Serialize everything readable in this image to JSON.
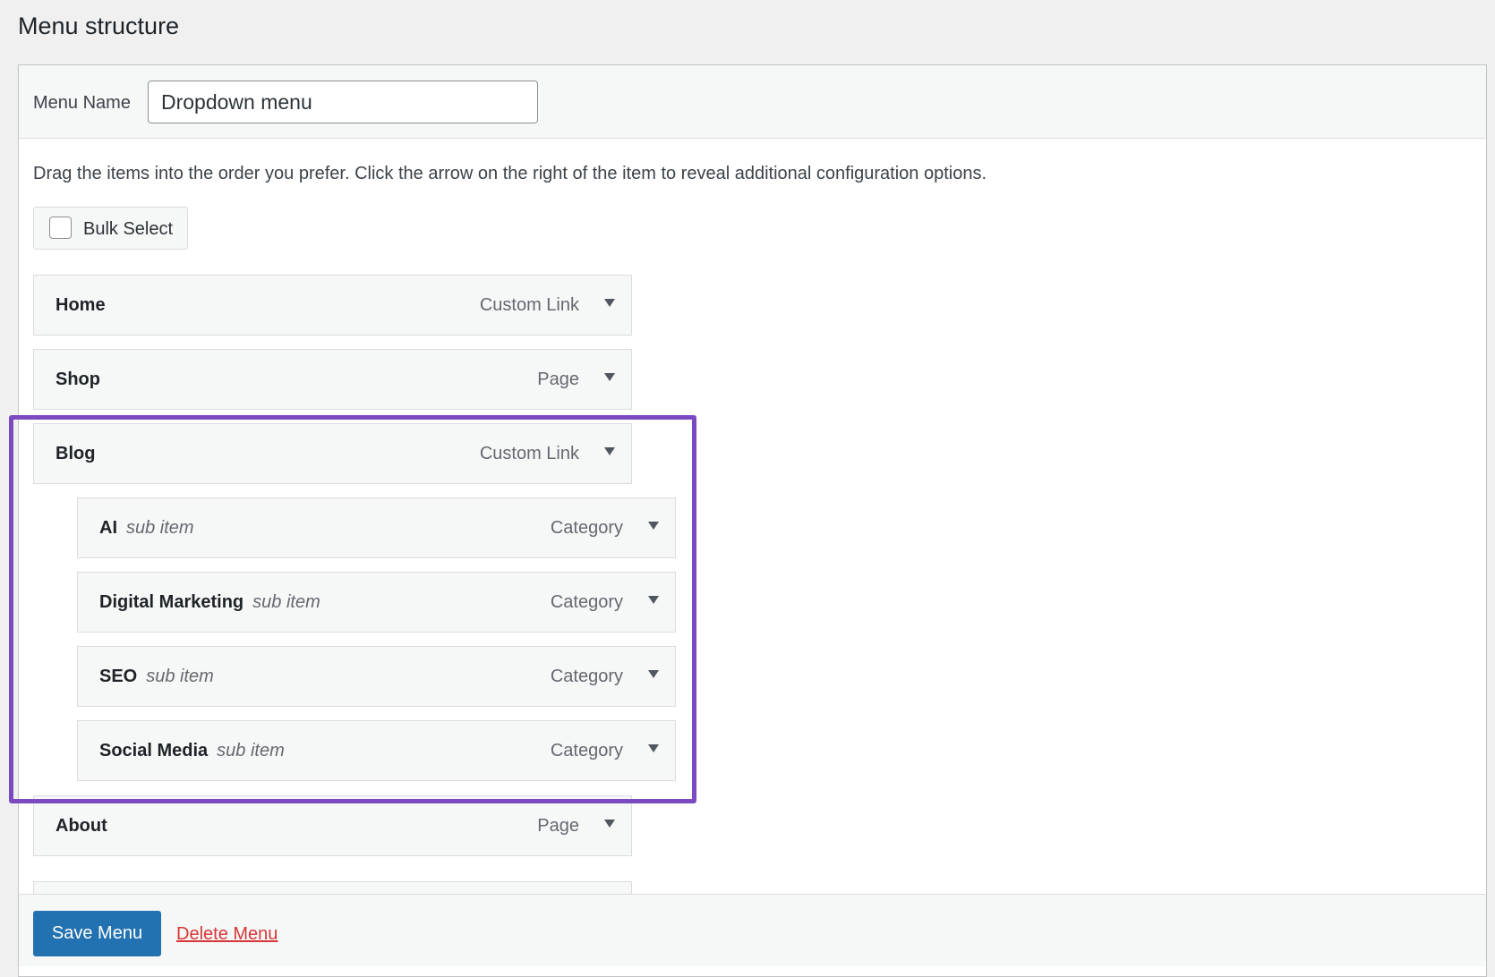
{
  "page": {
    "title": "Menu structure"
  },
  "menu_name": {
    "label": "Menu Name",
    "value": "Dropdown menu"
  },
  "instructions": "Drag the items into the order you prefer. Click the arrow on the right of the item to reveal additional configuration options.",
  "bulk_select": {
    "label": "Bulk Select",
    "checked": false
  },
  "items": [
    {
      "title": "Home",
      "type": "Custom Link"
    },
    {
      "title": "Shop",
      "type": "Page"
    },
    {
      "title": "Blog",
      "type": "Custom Link"
    },
    {
      "title": "AI",
      "sub": "sub item",
      "type": "Category"
    },
    {
      "title": "Digital Marketing",
      "sub": "sub item",
      "type": "Category"
    },
    {
      "title": "SEO",
      "sub": "sub item",
      "type": "Category"
    },
    {
      "title": "Social Media",
      "sub": "sub item",
      "type": "Category"
    },
    {
      "title": "About",
      "type": "Page"
    }
  ],
  "footer": {
    "save_label": "Save Menu",
    "delete_label": "Delete Menu"
  },
  "colors": {
    "primary": "#2271b1",
    "danger": "#d63638",
    "highlight": "#7b4ac0"
  }
}
